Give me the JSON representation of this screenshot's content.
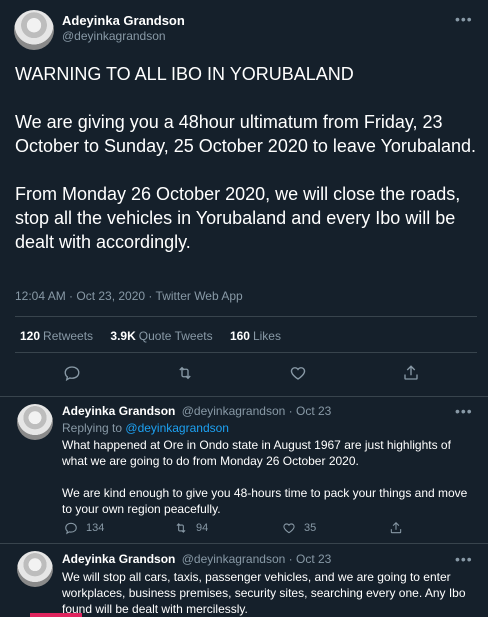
{
  "main_tweet": {
    "author_name": "Adeyinka Grandson",
    "author_handle": "@deyinkagrandson",
    "text": "WARNING TO ALL IBO IN YORUBALAND\n\nWe are giving you a 48hour ultimatum from Friday, 23 October to Sunday, 25 October 2020 to leave Yorubaland.\n\nFrom Monday 26 October 2020, we will close the roads, stop all the vehicles in Yorubaland and every Ibo will be dealt with accordingly.",
    "meta": "12:04 AM · Oct 23, 2020 · Twitter Web App",
    "stats": {
      "retweets_count": "120",
      "retweets_label": "Retweets",
      "quotes_count": "3.9K",
      "quotes_label": "Quote Tweets",
      "likes_count": "160",
      "likes_label": "Likes"
    }
  },
  "replies": [
    {
      "author_name": "Adeyinka Grandson",
      "author_handle": "@deyinkagrandson",
      "date": "· Oct 23",
      "replying_prefix": "Replying to",
      "replying_to": "@deyinkagrandson",
      "text": "What happened at Ore in Ondo state in August 1967 are just highlights of what we are going to do from Monday 26 October 2020.\n\nWe are kind enough to give you 48-hours time to pack your things and move to your own region peacefully.",
      "reply_count": "134",
      "retweet_count": "94",
      "like_count": "35"
    },
    {
      "author_name": "Adeyinka Grandson",
      "author_handle": "@deyinkagrandson",
      "date": "· Oct 23",
      "text": "We will stop all cars, taxis, passenger vehicles, and we are going to enter workplaces, business premises, security sites, searching every one. Any Ibo found will be dealt with mercilessly."
    }
  ],
  "more_glyph": "•••",
  "colors": {
    "background": "#15202b",
    "secondary_text": "#8899a6",
    "link": "#1da1f2",
    "divider": "#38444d"
  },
  "icons": [
    "reply-icon",
    "retweet-icon",
    "like-icon",
    "share-icon",
    "more-icon",
    "avatar"
  ]
}
